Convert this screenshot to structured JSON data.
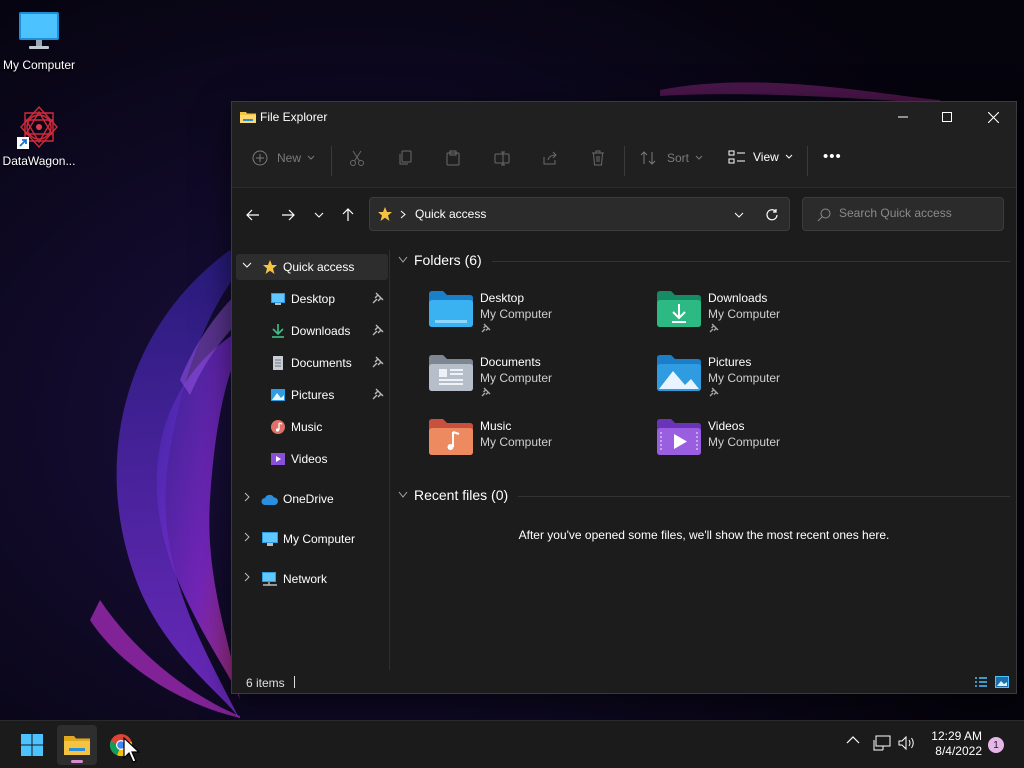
{
  "desktop": {
    "icons": [
      {
        "label": "My Computer",
        "icon": "monitor-icon"
      },
      {
        "label": "DataWagon...",
        "icon": "datawagon-shortcut-icon"
      }
    ]
  },
  "window": {
    "title": "File Explorer",
    "controls": {
      "minimize": "minimize-icon",
      "maximize": "maximize-icon",
      "close": "close-icon"
    }
  },
  "commandbar": {
    "new_label": "New",
    "sort_label": "Sort",
    "view_label": "View",
    "more_label": "•••"
  },
  "address": {
    "crumb": "Quick access",
    "search_placeholder": "Search Quick access"
  },
  "sidebar": {
    "quick_access": "Quick access",
    "items": [
      {
        "label": "Desktop",
        "pinned": true
      },
      {
        "label": "Downloads",
        "pinned": true
      },
      {
        "label": "Documents",
        "pinned": true
      },
      {
        "label": "Pictures",
        "pinned": true
      },
      {
        "label": "Music",
        "pinned": false
      },
      {
        "label": "Videos",
        "pinned": false
      }
    ],
    "onedrive": "OneDrive",
    "my_computer": "My Computer",
    "network": "Network"
  },
  "content": {
    "folders_heading": "Folders (6)",
    "folders": [
      {
        "name": "Desktop",
        "location": "My Computer",
        "pinned": true
      },
      {
        "name": "Downloads",
        "location": "My Computer",
        "pinned": true
      },
      {
        "name": "Documents",
        "location": "My Computer",
        "pinned": true
      },
      {
        "name": "Pictures",
        "location": "My Computer",
        "pinned": true
      },
      {
        "name": "Music",
        "location": "My Computer",
        "pinned": false
      },
      {
        "name": "Videos",
        "location": "My Computer",
        "pinned": false
      }
    ],
    "recent_heading": "Recent files (0)",
    "recent_empty": "After you've opened some files, we'll show the most recent ones here."
  },
  "status": {
    "count": "6 items"
  },
  "taskbar": {
    "apps": [
      {
        "name": "Start",
        "icon": "windows-start-icon"
      },
      {
        "name": "File Explorer",
        "icon": "file-explorer-icon",
        "active": true
      },
      {
        "name": "Google Chrome",
        "icon": "chrome-icon"
      }
    ],
    "time": "12:29 AM",
    "date": "8/4/2022",
    "notifications": "1"
  },
  "colors": {
    "accent": "#4cc2ff",
    "window_bg": "#1c1c1c",
    "taskbar_bg": "#1b1b1b",
    "folder_yellow": "#f5c342"
  }
}
